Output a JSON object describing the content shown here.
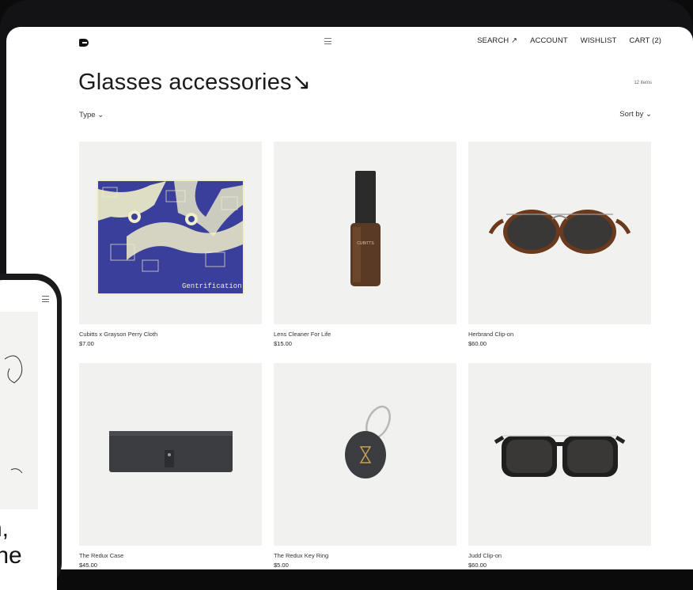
{
  "header": {
    "logo_text": "B",
    "nav": [
      "SEARCH ↗",
      "ACCOUNT",
      "WISHLIST",
      "CART (2)"
    ]
  },
  "page": {
    "title": "Glasses accessories↘",
    "item_count": "12 items",
    "filter_label": "Type ⌄",
    "sort_label": "Sort by ⌄"
  },
  "products": [
    {
      "name": "Cubitts x Grayson Perry Cloth",
      "price": "$7.00"
    },
    {
      "name": "Lens Cleaner For Life",
      "price": "$15.00"
    },
    {
      "name": "Herbrand Clip-on",
      "price": "$60.00"
    },
    {
      "name": "The Redux Case",
      "price": "$45.00"
    },
    {
      "name": "The Redux Key Ring",
      "price": "$5.00"
    },
    {
      "name": "Judd Clip-on",
      "price": "$60.00"
    }
  ],
  "product_art": {
    "cloth_text": "Gentrification",
    "bottle_brand": "CUBITTS"
  },
  "phone": {
    "text_line1": "n,",
    "text_line2": "the"
  },
  "colors": {
    "cloth_blue": "#3a3f9b",
    "cloth_cream": "#f1efc9",
    "bottle": "#5a3a24",
    "tortoise": "#6b3a1c"
  }
}
